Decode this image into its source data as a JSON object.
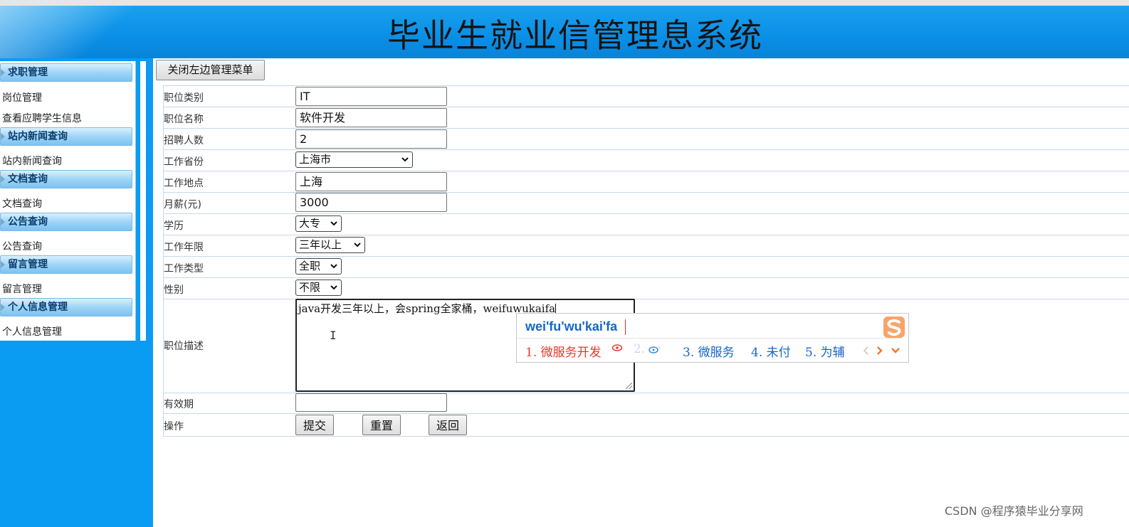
{
  "header": {
    "title": "毕业生就业信管理息系统"
  },
  "sidebar": {
    "sections": [
      {
        "title": "求职管理",
        "links": [
          "岗位管理",
          "查看应聘学生信息"
        ]
      },
      {
        "title": "站内新闻查询",
        "links": [
          "站内新闻查询"
        ]
      },
      {
        "title": "文档查询",
        "links": [
          "文档查询"
        ]
      },
      {
        "title": "公告查询",
        "links": [
          "公告查询"
        ]
      },
      {
        "title": "留言管理",
        "links": [
          "留言管理"
        ]
      },
      {
        "title": "个人信息管理",
        "links": [
          "个人信息管理"
        ]
      }
    ]
  },
  "toggle_menu_label": "关闭左边管理菜单",
  "form": {
    "job_category": {
      "label": "职位类别",
      "value": "IT"
    },
    "job_title": {
      "label": "职位名称",
      "value": "软件开发"
    },
    "headcount": {
      "label": "招聘人数",
      "value": "2"
    },
    "province": {
      "label": "工作省份",
      "value": "上海市"
    },
    "location": {
      "label": "工作地点",
      "value": "上海"
    },
    "salary": {
      "label": "月薪(元)",
      "value": "3000"
    },
    "education": {
      "label": "学历",
      "value": "大专"
    },
    "experience": {
      "label": "工作年限",
      "value": "三年以上"
    },
    "job_type": {
      "label": "工作类型",
      "value": "全职"
    },
    "gender": {
      "label": "性别",
      "value": "不限"
    },
    "description": {
      "label": "职位描述",
      "value": "java开发三年以上，会spring全家桶，weifuwukaifa"
    },
    "validity": {
      "label": "有效期",
      "value": ""
    },
    "actions": {
      "label": "操作",
      "submit": "提交",
      "reset": "重置",
      "back": "返回"
    }
  },
  "ime": {
    "pinyin": "wei'fu'wu'kai'fa",
    "candidates": [
      "1. 微服务开发",
      "2.",
      "3. 微服务",
      "4. 未付",
      "5. 为辅"
    ],
    "logo_icon": "sogou-s-icon"
  },
  "watermark": "CSDN @程序猿毕业分享网",
  "colors": {
    "header_blue": "#0a8fe6",
    "sidebar_blue": "#0a9cf2",
    "ime_first": "#e8382b",
    "ime_other": "#1567c8"
  }
}
